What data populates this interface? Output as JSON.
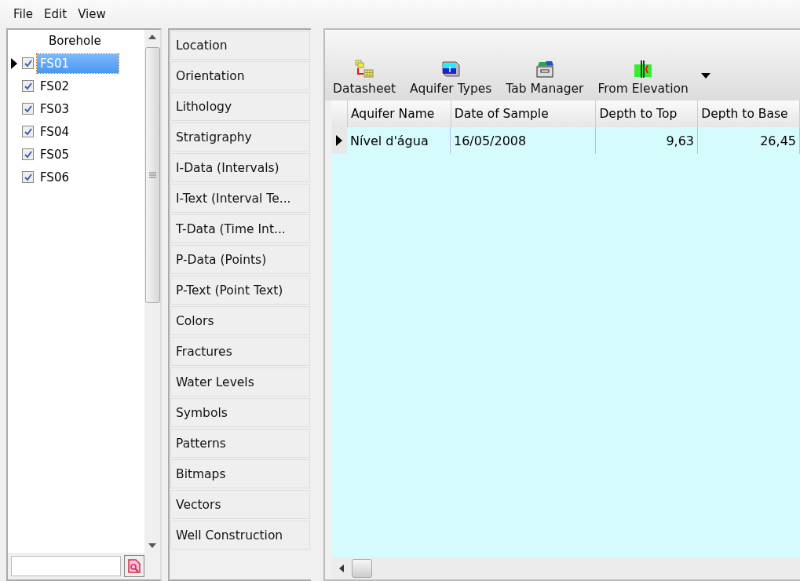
{
  "menu": [
    "File",
    "Edit",
    "View"
  ],
  "boreholes": {
    "column": "Borehole",
    "items": [
      {
        "name": "FS01",
        "checked": true,
        "selected": true,
        "current": true
      },
      {
        "name": "FS02",
        "checked": true,
        "selected": false,
        "current": false
      },
      {
        "name": "FS03",
        "checked": true,
        "selected": false,
        "current": false
      },
      {
        "name": "FS04",
        "checked": true,
        "selected": false,
        "current": false
      },
      {
        "name": "FS05",
        "checked": true,
        "selected": false,
        "current": false
      },
      {
        "name": "FS06",
        "checked": true,
        "selected": false,
        "current": false
      }
    ]
  },
  "tabs": [
    "Location",
    "Orientation",
    "Lithology",
    "Stratigraphy",
    "I-Data (Intervals)",
    "I-Text (Interval Te...",
    "T-Data (Time Int...",
    "P-Data (Points)",
    "P-Text (Point Text)",
    "Colors",
    "Fractures",
    "Water Levels",
    "Symbols",
    "Patterns",
    "Bitmaps",
    "Vectors",
    "Well Construction"
  ],
  "toolbar": [
    {
      "label": "Datasheet",
      "kind": "datasheet"
    },
    {
      "label": "Aquifer Types",
      "kind": "aquifer"
    },
    {
      "label": "Tab Manager",
      "kind": "tabs"
    },
    {
      "label": "From Elevation",
      "kind": "elevation"
    }
  ],
  "table": {
    "columns": [
      {
        "label": "Aquifer Name",
        "kind": "text"
      },
      {
        "label": "Date of Sample",
        "kind": "text"
      },
      {
        "label": "Depth to Top",
        "kind": "number"
      },
      {
        "label": "Depth to Base",
        "kind": "number"
      }
    ],
    "rows": [
      {
        "current": true,
        "cells": [
          "Nível d'água",
          "16/05/2008",
          "9,63",
          "26,45"
        ]
      }
    ]
  }
}
